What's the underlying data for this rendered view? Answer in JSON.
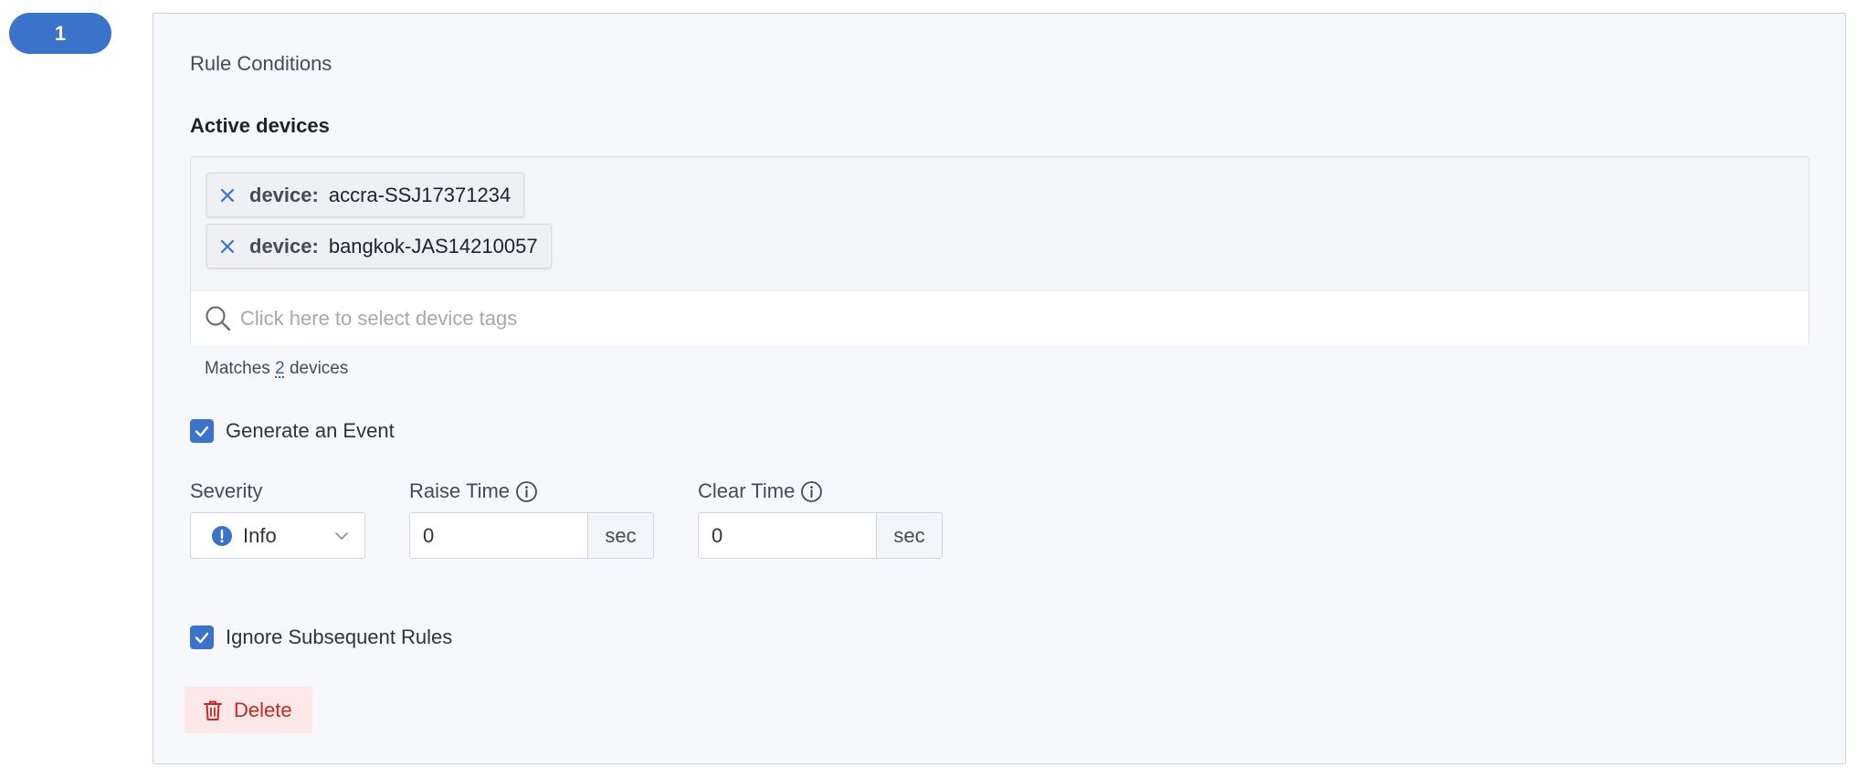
{
  "rule": {
    "number": "1",
    "section_title": "Rule Conditions",
    "active_devices_label": "Active devices",
    "tags": [
      {
        "key": "device:",
        "value": "accra-SSJ17371234"
      },
      {
        "key": "device:",
        "value": "bangkok-JAS14210057"
      }
    ],
    "search": {
      "placeholder": "Click here to select device tags",
      "value": ""
    },
    "matches": {
      "prefix": "Matches",
      "count": "2",
      "suffix": "devices"
    },
    "generate_event": {
      "label": "Generate an Event",
      "checked": true
    },
    "severity": {
      "label": "Severity",
      "value": "Info"
    },
    "raise_time": {
      "label": "Raise Time",
      "value": "0",
      "unit": "sec"
    },
    "clear_time": {
      "label": "Clear Time",
      "value": "0",
      "unit": "sec"
    },
    "ignore_subsequent": {
      "label": "Ignore Subsequent Rules",
      "checked": true
    },
    "delete_label": "Delete"
  },
  "colors": {
    "accent": "#3a73c9",
    "danger": "#c62828",
    "danger_bg": "#fde8e8",
    "panel_bg": "#f7f8fb"
  },
  "icons": {
    "tag_remove": "close-icon",
    "search": "search-icon",
    "info": "info-icon",
    "severity": "info-severity-icon",
    "dropdown": "chevron-down-icon",
    "checkbox": "checkmark-icon",
    "delete": "trash-icon"
  }
}
